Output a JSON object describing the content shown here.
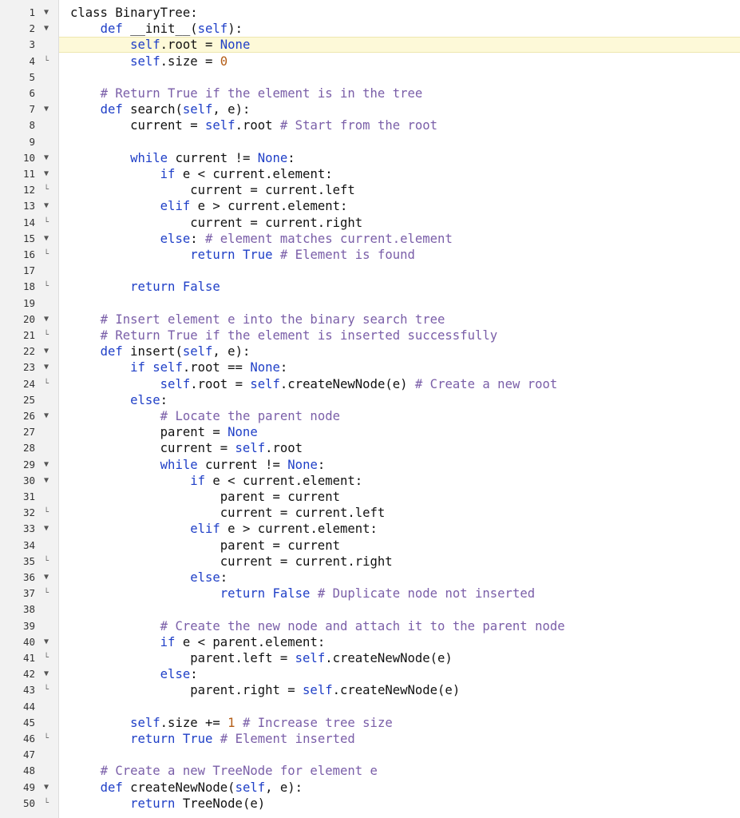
{
  "editor": {
    "colors": {
      "keyword": "#1f3fc7",
      "comment": "#7a5ea8",
      "number": "#b35d16",
      "text": "#111111",
      "gutter_bg": "#f2f2f2",
      "active_line": "#fdf9d8"
    },
    "active_line": 3,
    "lines": [
      {
        "n": "1",
        "fold": "open",
        "tokens": [
          [
            "t",
            "class BinaryTree:"
          ]
        ]
      },
      {
        "n": "2",
        "fold": "open",
        "tokens": [
          [
            "t",
            "    "
          ],
          [
            "k",
            "def"
          ],
          [
            "t",
            " __init__("
          ],
          [
            "k",
            "self"
          ],
          [
            "t",
            "):"
          ]
        ]
      },
      {
        "n": "3",
        "fold": "",
        "tokens": [
          [
            "t",
            "        "
          ],
          [
            "k",
            "self"
          ],
          [
            "t",
            ".root = "
          ],
          [
            "k",
            "None"
          ]
        ]
      },
      {
        "n": "4",
        "fold": "end",
        "tokens": [
          [
            "t",
            "        "
          ],
          [
            "k",
            "self"
          ],
          [
            "t",
            ".size = "
          ],
          [
            "n",
            "0"
          ]
        ]
      },
      {
        "n": "5",
        "fold": "",
        "tokens": []
      },
      {
        "n": "6",
        "fold": "",
        "tokens": [
          [
            "t",
            "    "
          ],
          [
            "c",
            "# Return True if the element is in the tree"
          ]
        ]
      },
      {
        "n": "7",
        "fold": "open",
        "tokens": [
          [
            "t",
            "    "
          ],
          [
            "k",
            "def"
          ],
          [
            "t",
            " search("
          ],
          [
            "k",
            "self"
          ],
          [
            "t",
            ", e):"
          ]
        ]
      },
      {
        "n": "8",
        "fold": "",
        "tokens": [
          [
            "t",
            "        current = "
          ],
          [
            "k",
            "self"
          ],
          [
            "t",
            ".root "
          ],
          [
            "c",
            "# Start from the root"
          ]
        ]
      },
      {
        "n": "9",
        "fold": "",
        "tokens": []
      },
      {
        "n": "10",
        "fold": "open",
        "tokens": [
          [
            "t",
            "        "
          ],
          [
            "k",
            "while"
          ],
          [
            "t",
            " current != "
          ],
          [
            "k",
            "None"
          ],
          [
            "t",
            ":"
          ]
        ]
      },
      {
        "n": "11",
        "fold": "open",
        "tokens": [
          [
            "t",
            "            "
          ],
          [
            "k",
            "if"
          ],
          [
            "t",
            " e < current.element:"
          ]
        ]
      },
      {
        "n": "12",
        "fold": "end",
        "tokens": [
          [
            "t",
            "                current = current.left"
          ]
        ]
      },
      {
        "n": "13",
        "fold": "open",
        "tokens": [
          [
            "t",
            "            "
          ],
          [
            "k",
            "elif"
          ],
          [
            "t",
            " e > current.element:"
          ]
        ]
      },
      {
        "n": "14",
        "fold": "end",
        "tokens": [
          [
            "t",
            "                current = current.right"
          ]
        ]
      },
      {
        "n": "15",
        "fold": "open",
        "tokens": [
          [
            "t",
            "            "
          ],
          [
            "k",
            "else"
          ],
          [
            "t",
            ": "
          ],
          [
            "c",
            "# element matches current.element"
          ]
        ]
      },
      {
        "n": "16",
        "fold": "end",
        "tokens": [
          [
            "t",
            "                "
          ],
          [
            "k",
            "return"
          ],
          [
            "t",
            " "
          ],
          [
            "k",
            "True"
          ],
          [
            "t",
            " "
          ],
          [
            "c",
            "# Element is found"
          ]
        ]
      },
      {
        "n": "17",
        "fold": "",
        "tokens": []
      },
      {
        "n": "18",
        "fold": "end",
        "tokens": [
          [
            "t",
            "        "
          ],
          [
            "k",
            "return"
          ],
          [
            "t",
            " "
          ],
          [
            "k",
            "False"
          ]
        ]
      },
      {
        "n": "19",
        "fold": "",
        "tokens": []
      },
      {
        "n": "20",
        "fold": "open",
        "tokens": [
          [
            "t",
            "    "
          ],
          [
            "c",
            "# Insert element e into the binary search tree"
          ]
        ]
      },
      {
        "n": "21",
        "fold": "end",
        "tokens": [
          [
            "t",
            "    "
          ],
          [
            "c",
            "# Return True if the element is inserted successfully"
          ]
        ]
      },
      {
        "n": "22",
        "fold": "open",
        "tokens": [
          [
            "t",
            "    "
          ],
          [
            "k",
            "def"
          ],
          [
            "t",
            " insert("
          ],
          [
            "k",
            "self"
          ],
          [
            "t",
            ", e):"
          ]
        ]
      },
      {
        "n": "23",
        "fold": "open",
        "tokens": [
          [
            "t",
            "        "
          ],
          [
            "k",
            "if"
          ],
          [
            "t",
            " "
          ],
          [
            "k",
            "self"
          ],
          [
            "t",
            ".root == "
          ],
          [
            "k",
            "None"
          ],
          [
            "t",
            ":"
          ]
        ]
      },
      {
        "n": "24",
        "fold": "end",
        "tokens": [
          [
            "t",
            "            "
          ],
          [
            "k",
            "self"
          ],
          [
            "t",
            ".root = "
          ],
          [
            "k",
            "self"
          ],
          [
            "t",
            ".createNewNode(e) "
          ],
          [
            "c",
            "# Create a new root"
          ]
        ]
      },
      {
        "n": "25",
        "fold": "",
        "tokens": [
          [
            "t",
            "        "
          ],
          [
            "k",
            "else"
          ],
          [
            "t",
            ":"
          ]
        ]
      },
      {
        "n": "26",
        "fold": "open",
        "tokens": [
          [
            "t",
            "            "
          ],
          [
            "c",
            "# Locate the parent node"
          ]
        ]
      },
      {
        "n": "27",
        "fold": "",
        "tokens": [
          [
            "t",
            "            parent = "
          ],
          [
            "k",
            "None"
          ]
        ]
      },
      {
        "n": "28",
        "fold": "",
        "tokens": [
          [
            "t",
            "            current = "
          ],
          [
            "k",
            "self"
          ],
          [
            "t",
            ".root"
          ]
        ]
      },
      {
        "n": "29",
        "fold": "open",
        "tokens": [
          [
            "t",
            "            "
          ],
          [
            "k",
            "while"
          ],
          [
            "t",
            " current != "
          ],
          [
            "k",
            "None"
          ],
          [
            "t",
            ":"
          ]
        ]
      },
      {
        "n": "30",
        "fold": "open",
        "tokens": [
          [
            "t",
            "                "
          ],
          [
            "k",
            "if"
          ],
          [
            "t",
            " e < current.element:"
          ]
        ]
      },
      {
        "n": "31",
        "fold": "",
        "tokens": [
          [
            "t",
            "                    parent = current"
          ]
        ]
      },
      {
        "n": "32",
        "fold": "end",
        "tokens": [
          [
            "t",
            "                    current = current.left"
          ]
        ]
      },
      {
        "n": "33",
        "fold": "open",
        "tokens": [
          [
            "t",
            "                "
          ],
          [
            "k",
            "elif"
          ],
          [
            "t",
            " e > current.element:"
          ]
        ]
      },
      {
        "n": "34",
        "fold": "",
        "tokens": [
          [
            "t",
            "                    parent = current"
          ]
        ]
      },
      {
        "n": "35",
        "fold": "end",
        "tokens": [
          [
            "t",
            "                    current = current.right"
          ]
        ]
      },
      {
        "n": "36",
        "fold": "open",
        "tokens": [
          [
            "t",
            "                "
          ],
          [
            "k",
            "else"
          ],
          [
            "t",
            ":"
          ]
        ]
      },
      {
        "n": "37",
        "fold": "end",
        "tokens": [
          [
            "t",
            "                    "
          ],
          [
            "k",
            "return"
          ],
          [
            "t",
            " "
          ],
          [
            "k",
            "False"
          ],
          [
            "t",
            " "
          ],
          [
            "c",
            "# Duplicate node not inserted"
          ]
        ]
      },
      {
        "n": "38",
        "fold": "",
        "tokens": []
      },
      {
        "n": "39",
        "fold": "",
        "tokens": [
          [
            "t",
            "            "
          ],
          [
            "c",
            "# Create the new node and attach it to the parent node"
          ]
        ]
      },
      {
        "n": "40",
        "fold": "open",
        "tokens": [
          [
            "t",
            "            "
          ],
          [
            "k",
            "if"
          ],
          [
            "t",
            " e < parent.element:"
          ]
        ]
      },
      {
        "n": "41",
        "fold": "end",
        "tokens": [
          [
            "t",
            "                parent.left = "
          ],
          [
            "k",
            "self"
          ],
          [
            "t",
            ".createNewNode(e)"
          ]
        ]
      },
      {
        "n": "42",
        "fold": "open",
        "tokens": [
          [
            "t",
            "            "
          ],
          [
            "k",
            "else"
          ],
          [
            "t",
            ":"
          ]
        ]
      },
      {
        "n": "43",
        "fold": "end",
        "tokens": [
          [
            "t",
            "                parent.right = "
          ],
          [
            "k",
            "self"
          ],
          [
            "t",
            ".createNewNode(e)"
          ]
        ]
      },
      {
        "n": "44",
        "fold": "",
        "tokens": []
      },
      {
        "n": "45",
        "fold": "",
        "tokens": [
          [
            "t",
            "        "
          ],
          [
            "k",
            "self"
          ],
          [
            "t",
            ".size += "
          ],
          [
            "n",
            "1"
          ],
          [
            "t",
            " "
          ],
          [
            "c",
            "# Increase tree size"
          ]
        ]
      },
      {
        "n": "46",
        "fold": "end",
        "tokens": [
          [
            "t",
            "        "
          ],
          [
            "k",
            "return"
          ],
          [
            "t",
            " "
          ],
          [
            "k",
            "True"
          ],
          [
            "t",
            " "
          ],
          [
            "c",
            "# Element inserted"
          ]
        ]
      },
      {
        "n": "47",
        "fold": "",
        "tokens": []
      },
      {
        "n": "48",
        "fold": "",
        "tokens": [
          [
            "t",
            "    "
          ],
          [
            "c",
            "# Create a new TreeNode for element e"
          ]
        ]
      },
      {
        "n": "49",
        "fold": "open",
        "tokens": [
          [
            "t",
            "    "
          ],
          [
            "k",
            "def"
          ],
          [
            "t",
            " createNewNode("
          ],
          [
            "k",
            "self"
          ],
          [
            "t",
            ", e):"
          ]
        ]
      },
      {
        "n": "50",
        "fold": "end",
        "tokens": [
          [
            "t",
            "        "
          ],
          [
            "k",
            "return"
          ],
          [
            "t",
            " TreeNode(e)"
          ]
        ]
      }
    ]
  }
}
